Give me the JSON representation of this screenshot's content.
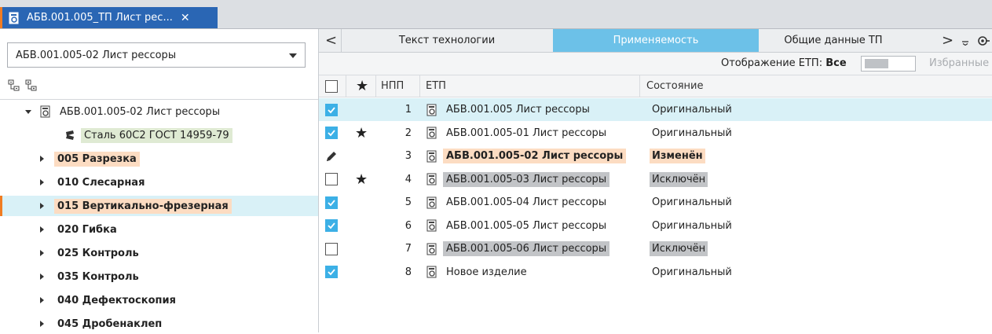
{
  "tab": {
    "title": "АБВ.001.005_ТП Лист рес...",
    "close": "✕"
  },
  "combo": {
    "value": "АБВ.001.005-02 Лист рессоры"
  },
  "tree": [
    {
      "label": "АБВ.001.005-02 Лист рессоры",
      "level": 0,
      "caret": "down",
      "icon": "document-icon",
      "style": ""
    },
    {
      "label": "Сталь 60С2 ГОСТ 14959-79",
      "level": 1,
      "caret": "",
      "icon": "material-icon",
      "style": "green"
    },
    {
      "label": "005 Разрезка",
      "level": 1,
      "caret": "right",
      "icon": "",
      "style": "orange"
    },
    {
      "label": "010 Слесарная",
      "level": 1,
      "caret": "right",
      "icon": "",
      "style": ""
    },
    {
      "label": "015 Вертикально-фрезерная",
      "level": 1,
      "caret": "right",
      "icon": "",
      "style": "orange",
      "selected": true
    },
    {
      "label": "020 Гибка",
      "level": 1,
      "caret": "right",
      "icon": "",
      "style": ""
    },
    {
      "label": "025 Контроль",
      "level": 1,
      "caret": "right",
      "icon": "",
      "style": ""
    },
    {
      "label": "035 Контроль",
      "level": 1,
      "caret": "right",
      "icon": "",
      "style": ""
    },
    {
      "label": "040 Дефектоскопия",
      "level": 1,
      "caret": "right",
      "icon": "",
      "style": ""
    },
    {
      "label": "045 Дробенаклеп",
      "level": 1,
      "caret": "right",
      "icon": "",
      "style": ""
    }
  ],
  "rtabs": {
    "prev": "<",
    "next": ">",
    "items": [
      "Текст технологии",
      "Применяемость",
      "Общие данные ТП"
    ],
    "active": 1
  },
  "toolbar": {
    "display_label": "Отображение ЕТП:",
    "display_value": "Все",
    "favorites": "Избранные"
  },
  "table": {
    "headers": {
      "star": "★",
      "npp": "НПП",
      "etp": "ЕТП",
      "state": "Состояние"
    },
    "rows": [
      {
        "checked": true,
        "star": false,
        "npp": "1",
        "name": "АБВ.001.005 Лист рессоры",
        "state": "Оригинальный",
        "kind": "normal",
        "selected": true
      },
      {
        "checked": true,
        "star": true,
        "npp": "2",
        "name": "АБВ.001.005-01 Лист рессоры",
        "state": "Оригинальный",
        "kind": "normal"
      },
      {
        "edit": true,
        "star": false,
        "npp": "3",
        "name": "АБВ.001.005-02 Лист рессоры",
        "state": "Изменён",
        "kind": "modified"
      },
      {
        "checked": false,
        "star": true,
        "npp": "4",
        "name": "АБВ.001.005-03 Лист рессоры",
        "state": "Исключён",
        "kind": "excluded"
      },
      {
        "checked": true,
        "star": false,
        "npp": "5",
        "name": "АБВ.001.005-04 Лист рессоры",
        "state": "Оригинальный",
        "kind": "normal"
      },
      {
        "checked": true,
        "star": false,
        "npp": "6",
        "name": "АБВ.001.005-05 Лист рессоры",
        "state": "Оригинальный",
        "kind": "normal"
      },
      {
        "checked": false,
        "star": false,
        "npp": "7",
        "name": "АБВ.001.005-06 Лист рессоры",
        "state": "Исключён",
        "kind": "excluded"
      },
      {
        "checked": true,
        "star": false,
        "npp": "8",
        "name": "Новое изделие",
        "state": "Оригинальный",
        "kind": "normal"
      }
    ]
  },
  "colors": {
    "tab_bg": "#2a66b4",
    "active_tab": "#6cc1e8",
    "accent_orange": "#f07c22",
    "selection": "#d9f1f7",
    "checkbox": "#3cb0e6"
  }
}
